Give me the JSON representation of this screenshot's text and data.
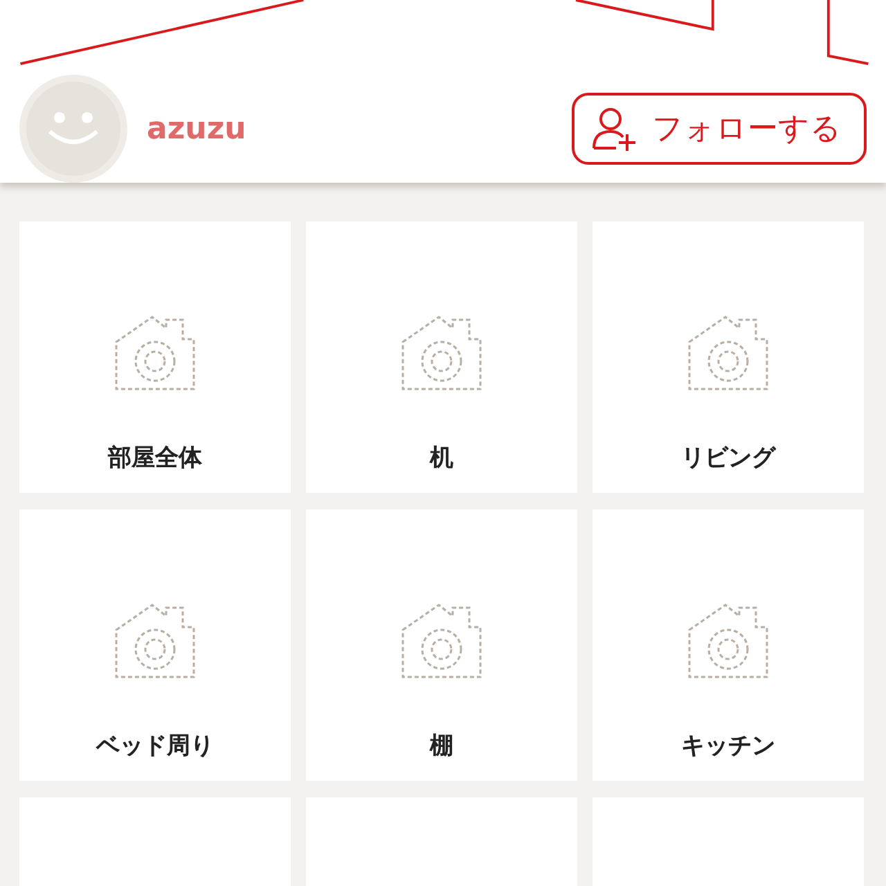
{
  "profile": {
    "username": "azuzu",
    "follow_button": "フォローする"
  },
  "tiles": [
    {
      "kind": "category",
      "label": "部屋全体"
    },
    {
      "kind": "category",
      "label": "机"
    },
    {
      "kind": "category",
      "label": "リビング"
    },
    {
      "kind": "category",
      "label": "ベッド周り"
    },
    {
      "kind": "category",
      "label": "棚"
    },
    {
      "kind": "category",
      "label": "キッチン"
    },
    {
      "kind": "blank"
    },
    {
      "kind": "blank"
    },
    {
      "kind": "blank"
    }
  ]
}
